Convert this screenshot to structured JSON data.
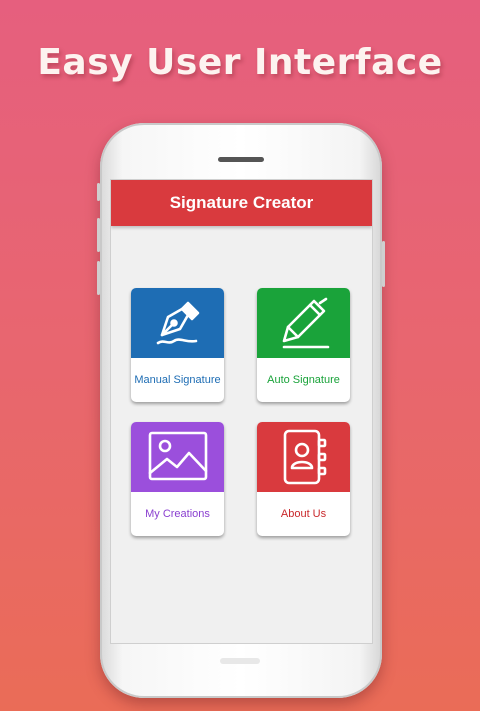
{
  "banner": {
    "headline": "Easy User Interface"
  },
  "app": {
    "title": "Signature Creator"
  },
  "menu": {
    "items": [
      {
        "label": "Manual Signature",
        "icon": "fountain-pen-icon",
        "color": "#1e6db4",
        "label_color": "#1e6db4"
      },
      {
        "label": "Auto Signature",
        "icon": "pen-icon",
        "color": "#1aa33a",
        "label_color": "#1aa33a"
      },
      {
        "label": "My Creations",
        "icon": "gallery-icon",
        "color": "#9b4fdc",
        "label_color": "#8a3fd0"
      },
      {
        "label": "About Us",
        "icon": "contact-book-icon",
        "color": "#d93a3e",
        "label_color": "#c9272b"
      }
    ]
  },
  "colors": {
    "background_top": "#e65f7e",
    "background_bottom": "#ea6c57",
    "appbar": "#d93a3e"
  }
}
